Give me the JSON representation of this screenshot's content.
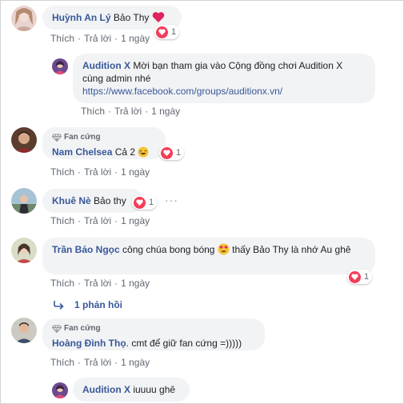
{
  "actions": {
    "like": "Thích",
    "reply": "Trả lời",
    "time": "1 ngày",
    "sep": "·"
  },
  "badge_label": "Fan cứng",
  "comments": [
    {
      "name": "Huỳnh An Lý",
      "text": "Bảo Thy",
      "reactions": "1"
    },
    {
      "name": "Audition X",
      "text": "Mời bạn tham gia vào Cộng đồng chơi Audition X cùng admin nhé",
      "link": "https://www.facebook.com/groups/auditionx.vn/"
    },
    {
      "name": "Nam Chelsea",
      "text": "Cả 2",
      "reactions": "1"
    },
    {
      "name": "Khuê Nè",
      "text": "Bảo thy",
      "reactions": "1",
      "more": "···"
    },
    {
      "name": "Trần Bảo Ngọc",
      "text_a": "công chúa bong bóng",
      "text_b": "thấy Bảo Thy là nhớ Au ghê",
      "reactions": "1"
    },
    {
      "name": "Hoàng Đình Thọ",
      "text": ". cmt để giữ fan cứng =)))))"
    },
    {
      "name": "Audition X",
      "text": "iuuuu ghê"
    }
  ],
  "replies_link": "1 phản hồi",
  "colors": {
    "link": "#385898",
    "bubble": "#f2f3f5",
    "heart": "#f33e58",
    "muted": "#606770"
  }
}
